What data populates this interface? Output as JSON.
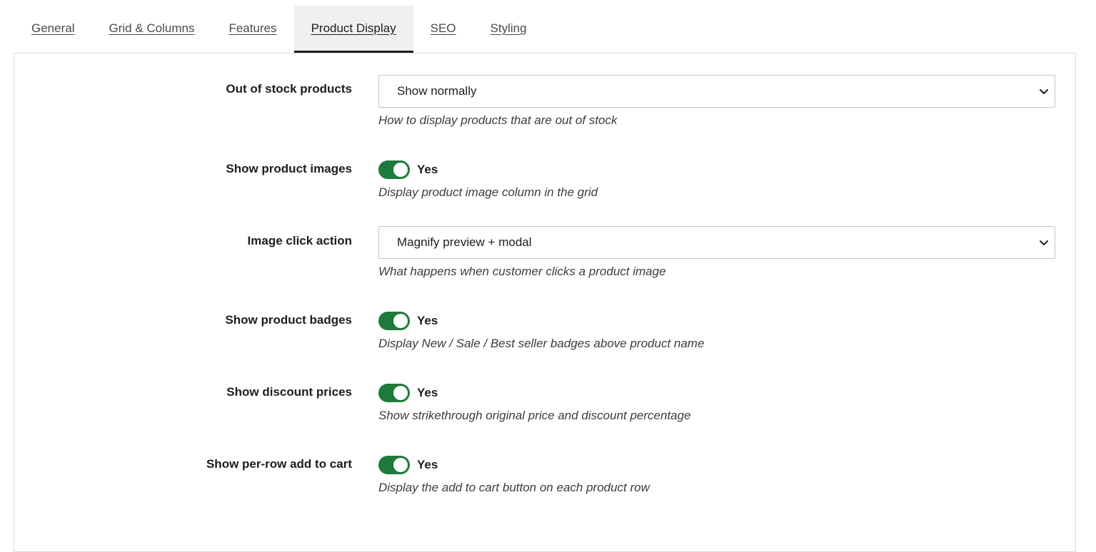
{
  "tabs": [
    {
      "label": "General"
    },
    {
      "label": "Grid & Columns"
    },
    {
      "label": "Features"
    },
    {
      "label": "Product Display"
    },
    {
      "label": "SEO"
    },
    {
      "label": "Styling"
    }
  ],
  "active_tab": "Product Display",
  "settings": {
    "out_of_stock": {
      "label": "Out of stock products",
      "value": "Show normally",
      "description": "How to display products that are out of stock"
    },
    "show_images": {
      "label": "Show product images",
      "state": "Yes",
      "description": "Display product image column in the grid"
    },
    "image_click": {
      "label": "Image click action",
      "value": "Magnify preview + modal",
      "description": "What happens when customer clicks a product image"
    },
    "show_badges": {
      "label": "Show product badges",
      "state": "Yes",
      "description": "Display New / Sale / Best seller badges above product name"
    },
    "show_discount": {
      "label": "Show discount prices",
      "state": "Yes",
      "description": "Show strikethrough original price and discount percentage"
    },
    "show_add_to_cart": {
      "label": "Show per-row add to cart",
      "state": "Yes",
      "description": "Display the add to cart button on each product row"
    }
  },
  "colors": {
    "toggle_on": "#1e7a3c",
    "active_tab_bg": "#f0f0f1",
    "border": "#dcdcde"
  }
}
